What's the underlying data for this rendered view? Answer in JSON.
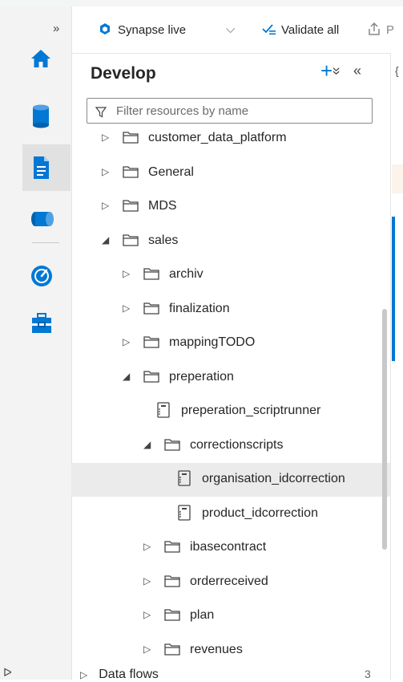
{
  "rail": {
    "expand_label": "»",
    "colors": {
      "home": "#0078d4",
      "data": "#0078d4",
      "develop": "#0078d4",
      "integrate": "#0078d4",
      "monitor": "#0078d4",
      "manage": "#0078d4"
    }
  },
  "toolbar": {
    "mode_label": "Synapse live",
    "dropdown_glyph": "⌵",
    "validate_label": "Validate all",
    "publish_label": "P"
  },
  "panel": {
    "title": "Develop",
    "add_glyph": "+",
    "sort_glyph": "»",
    "collapse_glyph": "«",
    "filter_placeholder": "Filter resources by name"
  },
  "tree": [
    {
      "label": "customer_data_platform",
      "type": "folder",
      "expanded": false,
      "depth": 0
    },
    {
      "label": "General",
      "type": "folder",
      "expanded": false,
      "depth": 0
    },
    {
      "label": "MDS",
      "type": "folder",
      "expanded": false,
      "depth": 0
    },
    {
      "label": "sales",
      "type": "folder",
      "expanded": true,
      "depth": 0
    },
    {
      "label": "archiv",
      "type": "folder",
      "expanded": false,
      "depth": 1
    },
    {
      "label": "finalization",
      "type": "folder",
      "expanded": false,
      "depth": 1
    },
    {
      "label": "mappingTODO",
      "type": "folder",
      "expanded": false,
      "depth": 1
    },
    {
      "label": "preperation",
      "type": "folder",
      "expanded": true,
      "depth": 1
    },
    {
      "label": "preperation_scriptrunner",
      "type": "script",
      "depth": 2
    },
    {
      "label": "correctionscripts",
      "type": "folder",
      "expanded": true,
      "depth": 2
    },
    {
      "label": "organisation_idcorrection",
      "type": "script",
      "depth": 3,
      "selected": true
    },
    {
      "label": "product_idcorrection",
      "type": "script",
      "depth": 3
    },
    {
      "label": "ibasecontract",
      "type": "folder",
      "expanded": false,
      "depth": 2
    },
    {
      "label": "orderreceived",
      "type": "folder",
      "expanded": false,
      "depth": 2
    },
    {
      "label": "plan",
      "type": "folder",
      "expanded": false,
      "depth": 2
    },
    {
      "label": "revenues",
      "type": "folder",
      "expanded": false,
      "depth": 2
    }
  ],
  "bottom": {
    "partial_label": "Data flows",
    "partial_count": "3",
    "left_cut": "ᐅ"
  },
  "side": {
    "top_glyph": "{"
  }
}
